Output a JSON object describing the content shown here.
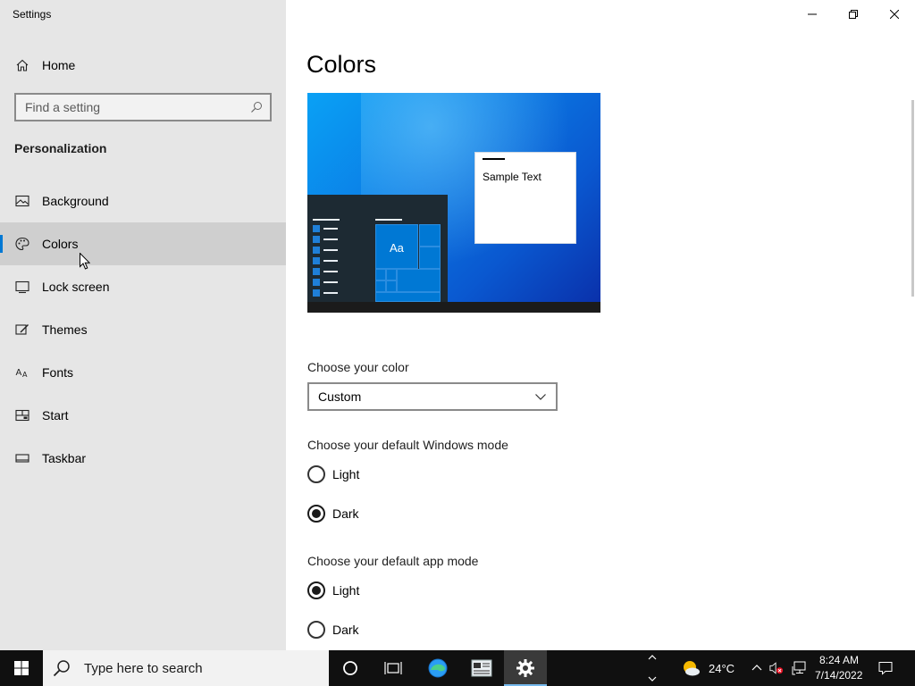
{
  "window": {
    "title": "Settings",
    "controls": {
      "minimize": "minimize",
      "restore": "restore",
      "close": "close"
    }
  },
  "sidebar": {
    "home_label": "Home",
    "search_placeholder": "Find a setting",
    "section_title": "Personalization",
    "items": [
      {
        "label": "Background",
        "icon": "picture-icon",
        "selected": false
      },
      {
        "label": "Colors",
        "icon": "palette-icon",
        "selected": true
      },
      {
        "label": "Lock screen",
        "icon": "lock-screen-icon",
        "selected": false
      },
      {
        "label": "Themes",
        "icon": "themes-icon",
        "selected": false
      },
      {
        "label": "Fonts",
        "icon": "fonts-icon",
        "selected": false
      },
      {
        "label": "Start",
        "icon": "start-icon",
        "selected": false
      },
      {
        "label": "Taskbar",
        "icon": "taskbar-icon",
        "selected": false
      }
    ]
  },
  "main": {
    "title": "Colors",
    "preview": {
      "sample_text": "Sample Text",
      "tile_label": "Aa"
    },
    "choose_color": {
      "label": "Choose your color",
      "value": "Custom"
    },
    "windows_mode": {
      "label": "Choose your default Windows mode",
      "options": [
        {
          "label": "Light",
          "checked": false
        },
        {
          "label": "Dark",
          "checked": true
        }
      ]
    },
    "app_mode": {
      "label": "Choose your default app mode",
      "options": [
        {
          "label": "Light",
          "checked": true
        },
        {
          "label": "Dark",
          "checked": false
        }
      ]
    }
  },
  "taskbar": {
    "search_placeholder": "Type here to search",
    "weather": {
      "temp": "24°C",
      "icon": "partly-sunny-icon"
    },
    "clock": {
      "time": "8:24 AM",
      "date": "7/14/2022"
    }
  },
  "colors": {
    "accent": "#0078d4",
    "sidebar_bg": "#e6e6e6",
    "selected_bg": "#cfcfcf",
    "taskbar_bg": "#101010"
  }
}
